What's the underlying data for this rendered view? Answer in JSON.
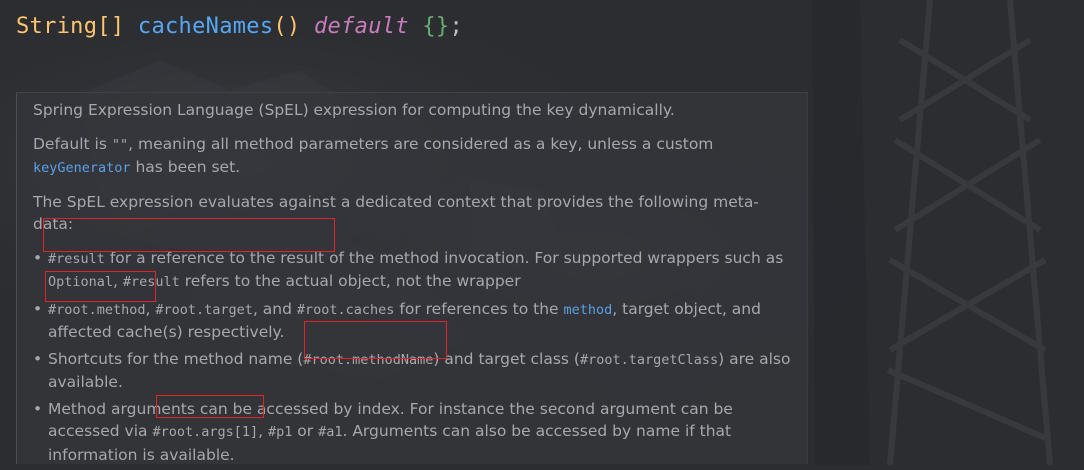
{
  "code": {
    "type": "String[]",
    "method": "cacheNames",
    "parens": "()",
    "keyword": "default",
    "braces": "{}",
    "semicolon": ";"
  },
  "doc": {
    "p1": "Spring Expression Language (SpEL) expression for computing the key dynamically.",
    "p2_part1": "Default is ",
    "p2_code": "\"\"",
    "p2_part2": ", meaning all method parameters are considered as a key, unless a custom",
    "p2_link": "keyGenerator",
    "p2_part3": " has been set.",
    "p3": "The SpEL expression evaluates against a dedicated context that provides the following meta-data:",
    "items": [
      {
        "code1": "#result",
        "text1": " for a reference to the result of the method invocation. For supported wrappers such as ",
        "code2": "Optional",
        "text2": ", ",
        "code3": "#result",
        "text3": " refers to the actual object, not the wrapper"
      },
      {
        "code1": "#root.method",
        "text1": ", ",
        "code2": "#root.target",
        "text2": ", and ",
        "code3": "#root.caches",
        "text3": " for references to the ",
        "link": "method",
        "text4": ", target object, and affected cache(s) respectively."
      },
      {
        "text1": "Shortcuts for the method name (",
        "code1": "#root.methodName",
        "text2": ") and target class (",
        "code2": "#root.targetClass",
        "text3": ") are also available."
      },
      {
        "text1": "Method arguments can be accessed by index. For instance the second argument can be accessed via ",
        "code1": "#root.args[1]",
        "text2": ", ",
        "code2": "#p1",
        "text3": " or ",
        "code3": "#a1",
        "text4": ". Arguments can also be accessed by name if that information is available."
      }
    ]
  },
  "colors": {
    "background": "#2b2d31",
    "doc_text": "#a5a8ae",
    "link": "#5aa0e6",
    "highlight": "#e0242a",
    "type": "#ffc66d",
    "function": "#56a8f5",
    "keyword": "#c77dbb",
    "braces": "#6aab73"
  }
}
